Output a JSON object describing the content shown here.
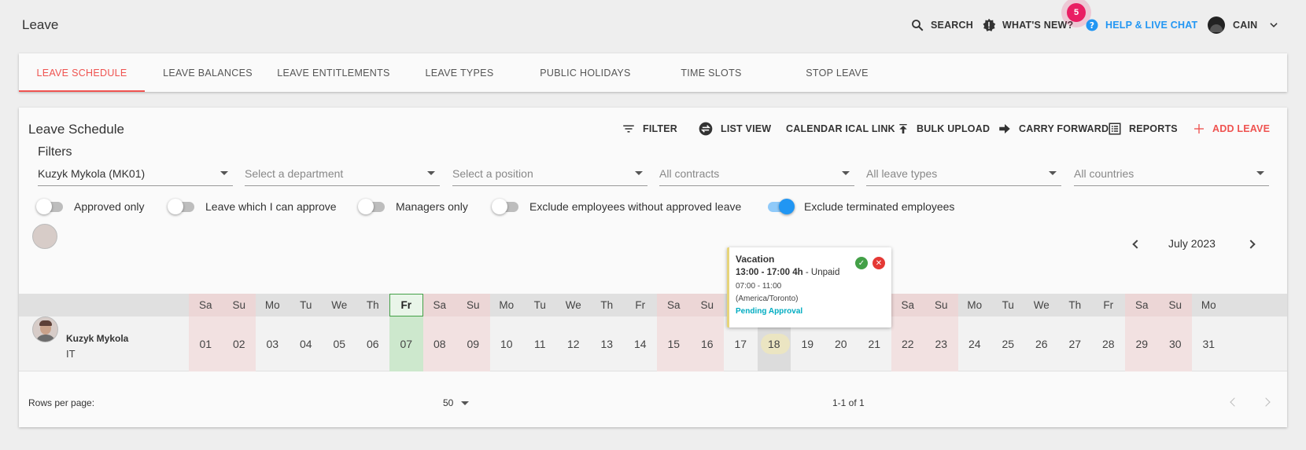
{
  "page": {
    "title": "Leave"
  },
  "topbar": {
    "search": "SEARCH",
    "whats_new": "WHAT'S NEW?",
    "whats_new_badge": "5",
    "help": "HELP & LIVE CHAT",
    "user": "CAIN"
  },
  "tabs": [
    {
      "label": "LEAVE SCHEDULE",
      "active": true
    },
    {
      "label": "LEAVE BALANCES"
    },
    {
      "label": "LEAVE ENTITLEMENTS"
    },
    {
      "label": "LEAVE TYPES"
    },
    {
      "label": "PUBLIC HOLIDAYS"
    },
    {
      "label": "TIME SLOTS"
    },
    {
      "label": "STOP LEAVE"
    }
  ],
  "card": {
    "title": "Leave Schedule",
    "actions": {
      "filter": "FILTER",
      "list_view": "LIST VIEW",
      "calendar_ical": "CALENDAR ICAL LINK",
      "bulk_upload": "BULK UPLOAD",
      "carry_forward": "CARRY FORWARD",
      "reports": "REPORTS",
      "add_leave": "ADD LEAVE"
    }
  },
  "filters": {
    "label": "Filters",
    "employee": "Kuzyk Mykola (MK01)",
    "department_placeholder": "Select a department",
    "position_placeholder": "Select a position",
    "contracts_placeholder": "All contracts",
    "leave_types_placeholder": "All leave types",
    "countries_placeholder": "All countries"
  },
  "toggles": [
    {
      "label": "Approved only",
      "on": false
    },
    {
      "label": "Leave which I can approve",
      "on": false
    },
    {
      "label": "Managers only",
      "on": false
    },
    {
      "label": "Exclude employees without approved leave",
      "on": false
    },
    {
      "label": "Exclude terminated employees",
      "on": true
    }
  ],
  "calendar": {
    "month": "July 2023",
    "weekday_headers": [
      "Sa",
      "Su",
      "Mo",
      "Tu",
      "We",
      "Th",
      "Fr",
      "Sa",
      "Su",
      "Mo",
      "Tu",
      "We",
      "Th",
      "Fr",
      "Sa",
      "Su",
      "Mo",
      "Tu",
      "We",
      "Th",
      "Fr",
      "Sa",
      "Su",
      "Mo",
      "Tu",
      "We",
      "Th",
      "Fr",
      "Sa",
      "Su",
      "Mo"
    ],
    "days": [
      "01",
      "02",
      "03",
      "04",
      "05",
      "06",
      "07",
      "08",
      "09",
      "10",
      "11",
      "12",
      "13",
      "14",
      "15",
      "16",
      "17",
      "18",
      "19",
      "20",
      "21",
      "22",
      "23",
      "24",
      "25",
      "26",
      "27",
      "28",
      "29",
      "30",
      "31"
    ],
    "today_day": "07",
    "selected_day": "18",
    "employee": {
      "name": "Kuzyk Mykola",
      "department": "IT"
    }
  },
  "tooltip": {
    "type": "Vacation",
    "time": "13:00 - 17:00 4h",
    "paid": " - Unpaid",
    "slot": "07:00 - 11:00",
    "timezone": "(America/Toronto)",
    "status": "Pending Approval",
    "status_color": "#00acc1"
  },
  "footer": {
    "rows_per_page_label": "Rows per page:",
    "rows_per_page": "50",
    "range": "1-1 of 1"
  },
  "colors": {
    "accent": "#ef5350",
    "help": "#2196f3",
    "today": "#43a047",
    "badge": "#e91e63"
  }
}
